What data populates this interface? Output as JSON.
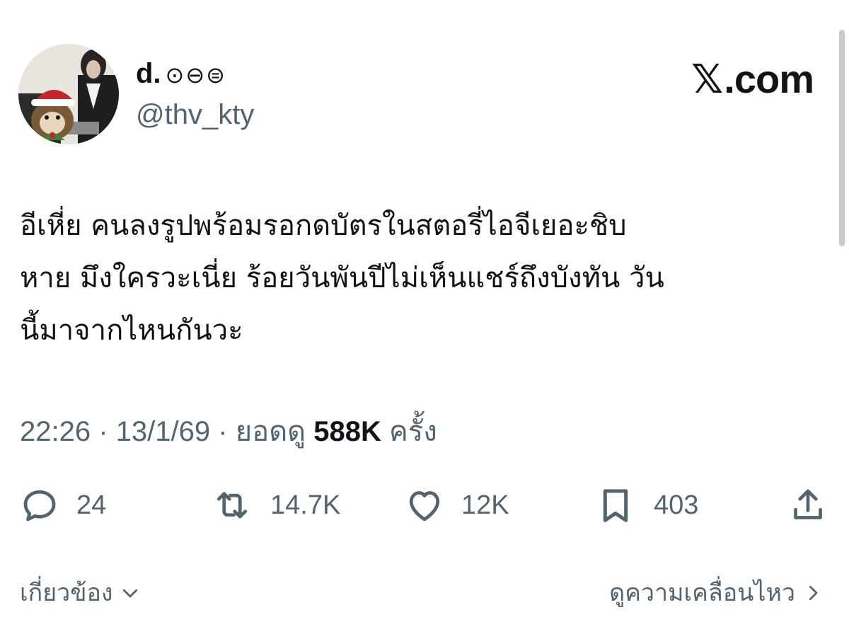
{
  "user": {
    "display_name": "d.",
    "name_emoji": "⊙⊖⊜",
    "handle": "@thv_kty"
  },
  "brand": {
    "mark": "𝕏",
    "text": ".com"
  },
  "tweet": {
    "lines": [
      "อีเหี่ย คนลงรูปพร้อมรอกดบัตรในสตอรี่ไอจีเยอะชิบ",
      "หาย มึงใครวะเนี่ย ร้อยวันพันปีไม่เห็นแชร์ถึงบังทัน วัน",
      "นี้มาจากไหนกันวะ"
    ]
  },
  "meta": {
    "time": "22:26",
    "date": "13/1/69",
    "views_label": "ยอดดู",
    "views_count": "588K",
    "views_suffix": "ครั้ง"
  },
  "actions": {
    "replies": "24",
    "reposts": "14.7K",
    "likes": "12K",
    "bookmarks": "403"
  },
  "footer": {
    "related_label": "เกี่ยวข้อง",
    "view_quotes_label": "ดูความเคลื่อนไหว"
  },
  "colors": {
    "text_primary": "#0f1419",
    "text_secondary": "#536471",
    "background": "#ffffff"
  }
}
